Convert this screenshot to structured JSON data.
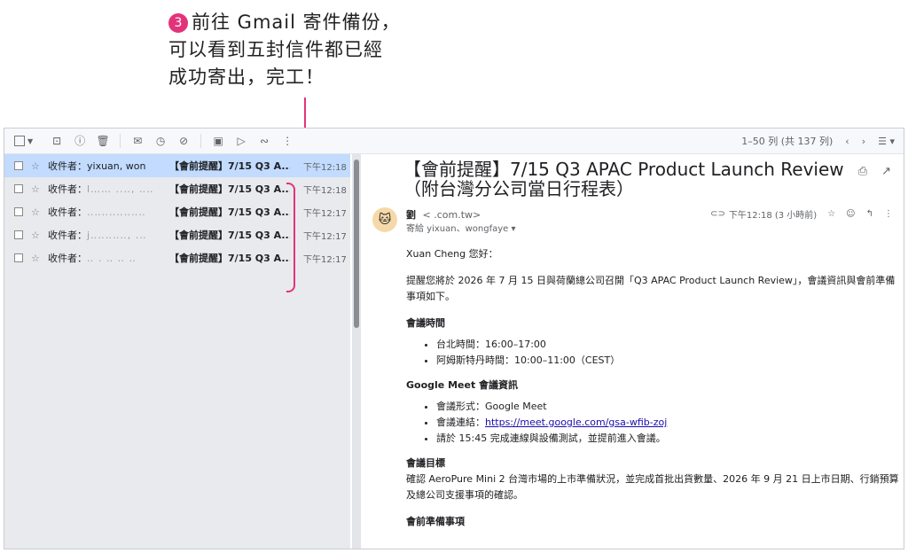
{
  "callout": {
    "number": "3",
    "line1": "前往 Gmail 寄件備份，",
    "line2": "可以看到五封信件都已經",
    "line3": "成功寄出，完工！"
  },
  "toolbar": {
    "pagination": "1–50 列 (共 137 列)"
  },
  "list": {
    "rows": [
      {
        "from_label": "收件者：",
        "from": "yixuan, won",
        "subject": "【會前提醒】7/15 Q3 A...",
        "time": "下午12:18"
      },
      {
        "from_label": "收件者：",
        "from": "l…… ..‥, ‥‥.‥‥;",
        "subject": "【會前提醒】7/15 Q3 A...",
        "time": "下午12:18"
      },
      {
        "from_label": "收件者：",
        "from": "‥‥‥‥‥‥‥‥",
        "subject": "【會前提醒】7/15 Q3 A...",
        "time": "下午12:17"
      },
      {
        "from_label": "收件者：",
        "from": "j‥‥‥‥‥, .‥",
        "subject": "【會前提醒】7/15 Q3 A...",
        "time": "下午12:17"
      },
      {
        "from_label": "收件者：",
        "from": "‥ . ‥ ‥ ‥",
        "subject": "【會前提醒】7/15 Q3 A...",
        "time": "下午12:17"
      }
    ]
  },
  "message": {
    "subject": "【會前提醒】7/15 Q3 APAC Product Launch Review（附台灣分公司當日行程表）",
    "sender_name": "劉",
    "sender_email": "<                    .com.tw>",
    "to": "寄給 yixuan、wongfaye ▾",
    "time": "下午12:18 (3 小時前)",
    "greeting": "Xuan Cheng 您好：",
    "intro": "提醒您將於 2026 年 7 月 15 日與荷蘭總公司召開「Q3 APAC Product Launch Review」，會議資訊與會前準備事項如下。",
    "section1_title": "會議時間",
    "section1_items": [
      "台北時間：16:00–17:00",
      "阿姆斯特丹時間：10:00–11:00（CEST）"
    ],
    "section2_title": "Google Meet 會議資訊",
    "section2_item1": "會議形式：Google Meet",
    "section2_link_label": "會議連結：",
    "section2_link": "https://meet.google.com/gsa-wfib-zoj",
    "section2_item3": "請於 15:45 完成連線與設備測試，並提前進入會議。",
    "section3_title": "會議目標",
    "section3_text": "確認 AeroPure Mini 2 台灣市場的上市準備狀況，並完成首批出貨數量、2026 年 9 月 21 日上市日期、行銷預算及總公司支援事項的確認。",
    "section4_title": "會前準備事項"
  }
}
